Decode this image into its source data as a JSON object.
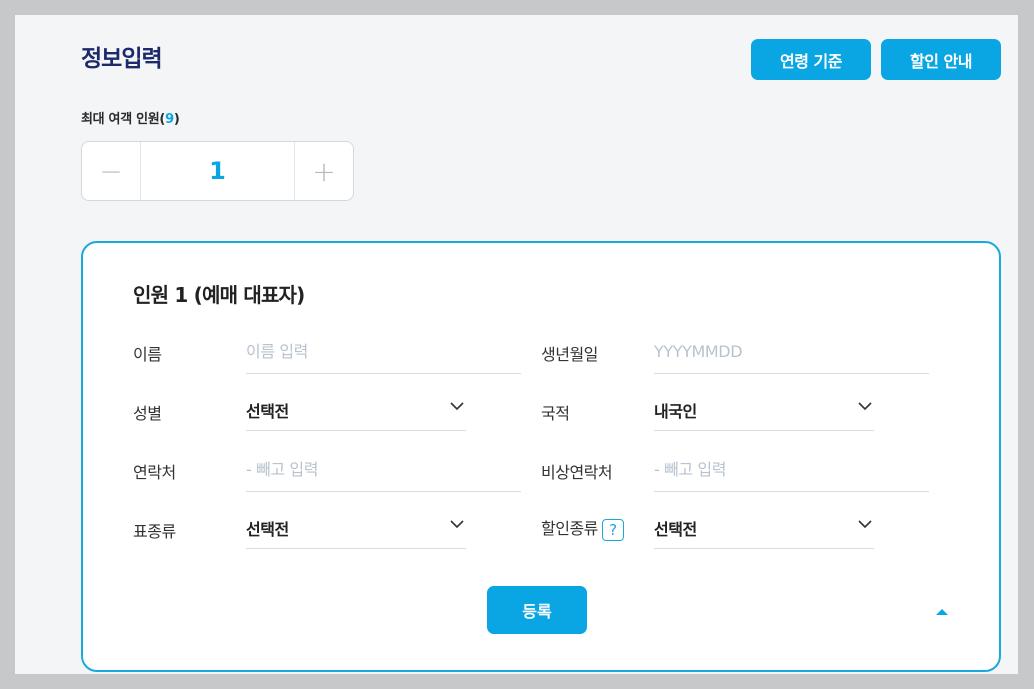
{
  "header": {
    "title": "정보입력",
    "age_button": "연령 기준",
    "discount_button": "할인 안내"
  },
  "passengers": {
    "max_label_prefix": "최대 여객 인원(",
    "max_count": "9",
    "max_label_suffix": ")",
    "count": "1",
    "minus_symbol": "−",
    "plus_symbol": "+"
  },
  "card": {
    "title": "인원 1 (예매 대표자)",
    "fields": {
      "name": {
        "label": "이름",
        "placeholder": "이름 입력",
        "value": ""
      },
      "birth": {
        "label": "생년월일",
        "placeholder": "YYYYMMDD",
        "value": ""
      },
      "gender": {
        "label": "성별",
        "value": "선택전"
      },
      "nationality": {
        "label": "국적",
        "value": "내국인"
      },
      "contact": {
        "label": "연락처",
        "placeholder": "- 빼고 입력",
        "value": ""
      },
      "emergency": {
        "label": "비상연락처",
        "placeholder": "- 빼고 입력",
        "value": ""
      },
      "ticket_type": {
        "label": "표종류",
        "value": "선택전"
      },
      "discount_type": {
        "label": "할인종류",
        "help": "?",
        "value": "선택전"
      }
    },
    "register_button": "등록"
  },
  "icons": {
    "chevron": "chevron-down-icon",
    "collapse": "caret-up-icon"
  },
  "colors": {
    "accent": "#0aa5e3",
    "title": "#1c2a6b",
    "card_border": "#1aa9dc",
    "placeholder": "#b8c3cf"
  }
}
